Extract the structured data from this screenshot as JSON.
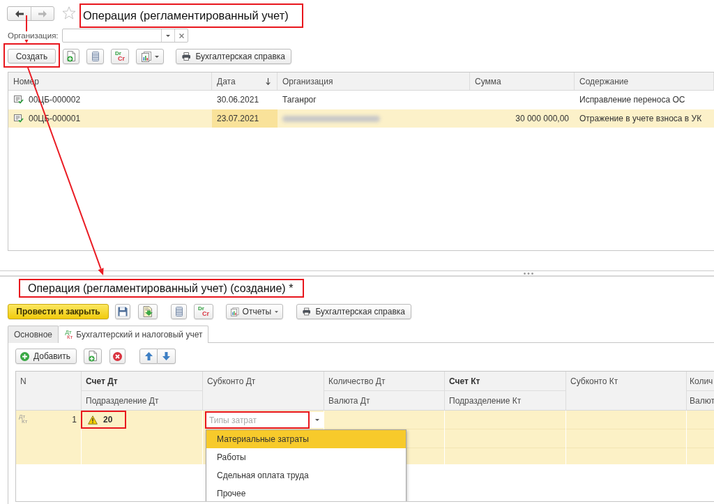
{
  "list_form": {
    "navigation": [
      {
        "kind": "back",
        "disabled": false
      },
      {
        "kind": "forward",
        "disabled": true
      }
    ],
    "title": "Операция (регламентированный учет)",
    "title_highlighted": true,
    "filter": {
      "label": "Организация:"
    },
    "toolbar": {
      "create": {
        "label": "Создать",
        "highlighted": true
      },
      "drcr": {
        "debit": "Dr",
        "credit": "Cr"
      },
      "report": {
        "label": "Бухгалтерская справка"
      }
    },
    "table": {
      "columns": [
        {
          "label": "Номер",
          "sort_descending": false
        },
        {
          "label": "Дата",
          "sort_descending": true
        },
        {
          "label": "Организация",
          "sort_descending": false
        },
        {
          "label": "Сумма",
          "sort_descending": false
        },
        {
          "label": "Содержание",
          "sort_descending": false
        }
      ],
      "rows": [
        {
          "number": "00ЦБ-000002",
          "date": "30.06.2021",
          "organization": "Таганрог",
          "organization_hidden": false,
          "content": "Исправление переноса ОС",
          "selected": false
        },
        {
          "number": "00ЦБ-000001",
          "date": "23.07.2021",
          "organization_hidden": true,
          "sum": "30 000 000,00",
          "content": "Отражение в учете взноса в УК",
          "selected": true
        }
      ]
    }
  },
  "document_form": {
    "title": "Операция (регламентированный учет) (создание) *",
    "title_highlighted": true,
    "toolbar": {
      "post_and_close": "Провести и закрыть",
      "drcr": {
        "debit": "Dr",
        "credit": "Cr"
      },
      "reports": "Отчеты",
      "report": "Бухгалтерская справка"
    },
    "tabs": [
      {
        "label": "Основное",
        "selected": false
      },
      {
        "label": "Бухгалтерский и налоговый учет",
        "selected": true,
        "marks": {
          "debit": "Дт",
          "credit": "Кт"
        }
      }
    ],
    "entries_toolbar": {
      "add": "Добавить"
    },
    "entries_table": {
      "columns": [
        {
          "label": "N",
          "emphasized": false
        },
        {
          "label": "Счет Дт",
          "sublabel": "Подразделение Дт",
          "emphasized": true
        },
        {
          "label": "Субконто Дт",
          "emphasized": false
        },
        {
          "label": "Количество Дт",
          "sublabel": "Валюта Дт",
          "emphasized": false
        },
        {
          "label": "Счет Кт",
          "sublabel": "Подразделение Кт",
          "emphasized": true
        },
        {
          "label": "Субконто Кт",
          "emphasized": false
        },
        {
          "label": "Колич",
          "sublabel": "Валют",
          "emphasized": false
        }
      ],
      "rows": [
        {
          "marks": {
            "debit": "Дт",
            "credit": "Кт"
          },
          "number": "1",
          "debit_account": "20",
          "debit_account_warning": true,
          "debit_account_highlighted": true,
          "debit_subconto": {
            "placeholder": "Типы затрат",
            "highlighted": true,
            "options": [
              {
                "label": "Материальные затраты",
                "selected": true
              },
              {
                "label": "Работы",
                "selected": false
              },
              {
                "label": "Сдельная оплата труда",
                "selected": false
              },
              {
                "label": "Прочее",
                "selected": false
              }
            ]
          },
          "selected": true
        }
      ]
    }
  }
}
